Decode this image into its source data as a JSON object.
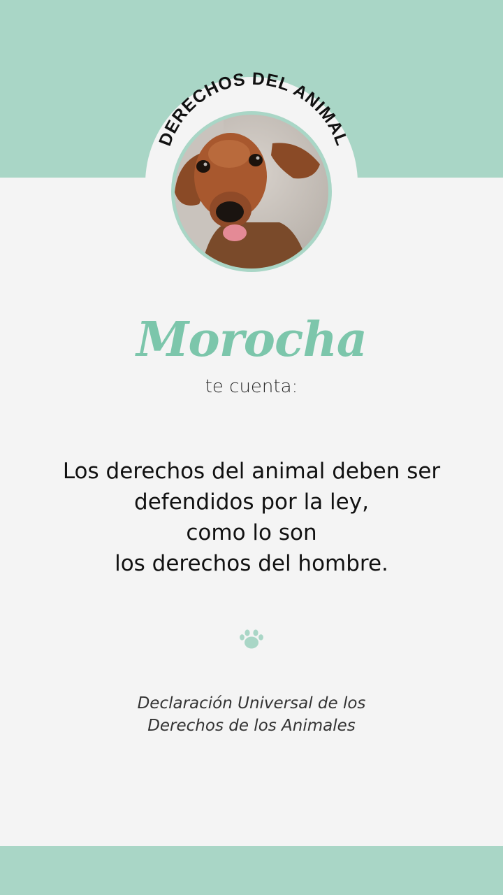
{
  "colors": {
    "accent": "#a9d6c6",
    "name": "#7cc6ab",
    "background": "#f4f4f4"
  },
  "badge": {
    "title": "DERECHOS DEL ANIMAL"
  },
  "dog_name": "Morocha",
  "subtitle": "te cuenta:",
  "quote": {
    "line1": "Los derechos del animal deben ser",
    "line2": "defendidos por la ley,",
    "line3": "como lo son",
    "line4": "los derechos del hombre."
  },
  "divider_icon": "paw-icon",
  "source": {
    "line1": "Declaración Universal de los",
    "line2": "Derechos de los Animales"
  }
}
